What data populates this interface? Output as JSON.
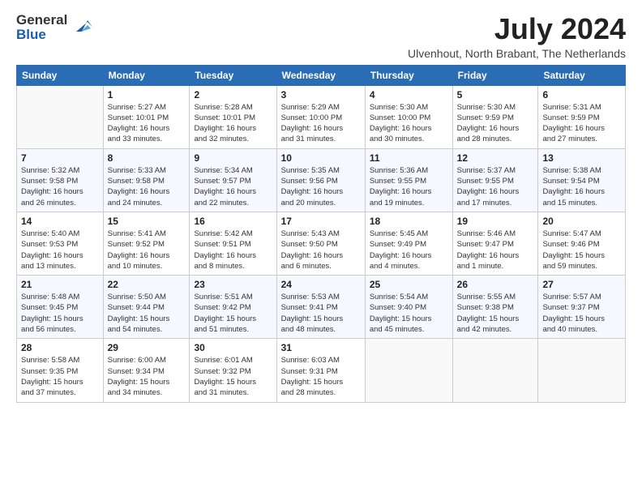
{
  "logo": {
    "line1": "General",
    "line2": "Blue"
  },
  "title": "July 2024",
  "location": "Ulvenhout, North Brabant, The Netherlands",
  "headers": [
    "Sunday",
    "Monday",
    "Tuesday",
    "Wednesday",
    "Thursday",
    "Friday",
    "Saturday"
  ],
  "weeks": [
    [
      {
        "day": "",
        "info": ""
      },
      {
        "day": "1",
        "info": "Sunrise: 5:27 AM\nSunset: 10:01 PM\nDaylight: 16 hours\nand 33 minutes."
      },
      {
        "day": "2",
        "info": "Sunrise: 5:28 AM\nSunset: 10:01 PM\nDaylight: 16 hours\nand 32 minutes."
      },
      {
        "day": "3",
        "info": "Sunrise: 5:29 AM\nSunset: 10:00 PM\nDaylight: 16 hours\nand 31 minutes."
      },
      {
        "day": "4",
        "info": "Sunrise: 5:30 AM\nSunset: 10:00 PM\nDaylight: 16 hours\nand 30 minutes."
      },
      {
        "day": "5",
        "info": "Sunrise: 5:30 AM\nSunset: 9:59 PM\nDaylight: 16 hours\nand 28 minutes."
      },
      {
        "day": "6",
        "info": "Sunrise: 5:31 AM\nSunset: 9:59 PM\nDaylight: 16 hours\nand 27 minutes."
      }
    ],
    [
      {
        "day": "7",
        "info": "Sunrise: 5:32 AM\nSunset: 9:58 PM\nDaylight: 16 hours\nand 26 minutes."
      },
      {
        "day": "8",
        "info": "Sunrise: 5:33 AM\nSunset: 9:58 PM\nDaylight: 16 hours\nand 24 minutes."
      },
      {
        "day": "9",
        "info": "Sunrise: 5:34 AM\nSunset: 9:57 PM\nDaylight: 16 hours\nand 22 minutes."
      },
      {
        "day": "10",
        "info": "Sunrise: 5:35 AM\nSunset: 9:56 PM\nDaylight: 16 hours\nand 20 minutes."
      },
      {
        "day": "11",
        "info": "Sunrise: 5:36 AM\nSunset: 9:55 PM\nDaylight: 16 hours\nand 19 minutes."
      },
      {
        "day": "12",
        "info": "Sunrise: 5:37 AM\nSunset: 9:55 PM\nDaylight: 16 hours\nand 17 minutes."
      },
      {
        "day": "13",
        "info": "Sunrise: 5:38 AM\nSunset: 9:54 PM\nDaylight: 16 hours\nand 15 minutes."
      }
    ],
    [
      {
        "day": "14",
        "info": "Sunrise: 5:40 AM\nSunset: 9:53 PM\nDaylight: 16 hours\nand 13 minutes."
      },
      {
        "day": "15",
        "info": "Sunrise: 5:41 AM\nSunset: 9:52 PM\nDaylight: 16 hours\nand 10 minutes."
      },
      {
        "day": "16",
        "info": "Sunrise: 5:42 AM\nSunset: 9:51 PM\nDaylight: 16 hours\nand 8 minutes."
      },
      {
        "day": "17",
        "info": "Sunrise: 5:43 AM\nSunset: 9:50 PM\nDaylight: 16 hours\nand 6 minutes."
      },
      {
        "day": "18",
        "info": "Sunrise: 5:45 AM\nSunset: 9:49 PM\nDaylight: 16 hours\nand 4 minutes."
      },
      {
        "day": "19",
        "info": "Sunrise: 5:46 AM\nSunset: 9:47 PM\nDaylight: 16 hours\nand 1 minute."
      },
      {
        "day": "20",
        "info": "Sunrise: 5:47 AM\nSunset: 9:46 PM\nDaylight: 15 hours\nand 59 minutes."
      }
    ],
    [
      {
        "day": "21",
        "info": "Sunrise: 5:48 AM\nSunset: 9:45 PM\nDaylight: 15 hours\nand 56 minutes."
      },
      {
        "day": "22",
        "info": "Sunrise: 5:50 AM\nSunset: 9:44 PM\nDaylight: 15 hours\nand 54 minutes."
      },
      {
        "day": "23",
        "info": "Sunrise: 5:51 AM\nSunset: 9:42 PM\nDaylight: 15 hours\nand 51 minutes."
      },
      {
        "day": "24",
        "info": "Sunrise: 5:53 AM\nSunset: 9:41 PM\nDaylight: 15 hours\nand 48 minutes."
      },
      {
        "day": "25",
        "info": "Sunrise: 5:54 AM\nSunset: 9:40 PM\nDaylight: 15 hours\nand 45 minutes."
      },
      {
        "day": "26",
        "info": "Sunrise: 5:55 AM\nSunset: 9:38 PM\nDaylight: 15 hours\nand 42 minutes."
      },
      {
        "day": "27",
        "info": "Sunrise: 5:57 AM\nSunset: 9:37 PM\nDaylight: 15 hours\nand 40 minutes."
      }
    ],
    [
      {
        "day": "28",
        "info": "Sunrise: 5:58 AM\nSunset: 9:35 PM\nDaylight: 15 hours\nand 37 minutes."
      },
      {
        "day": "29",
        "info": "Sunrise: 6:00 AM\nSunset: 9:34 PM\nDaylight: 15 hours\nand 34 minutes."
      },
      {
        "day": "30",
        "info": "Sunrise: 6:01 AM\nSunset: 9:32 PM\nDaylight: 15 hours\nand 31 minutes."
      },
      {
        "day": "31",
        "info": "Sunrise: 6:03 AM\nSunset: 9:31 PM\nDaylight: 15 hours\nand 28 minutes."
      },
      {
        "day": "",
        "info": ""
      },
      {
        "day": "",
        "info": ""
      },
      {
        "day": "",
        "info": ""
      }
    ]
  ]
}
